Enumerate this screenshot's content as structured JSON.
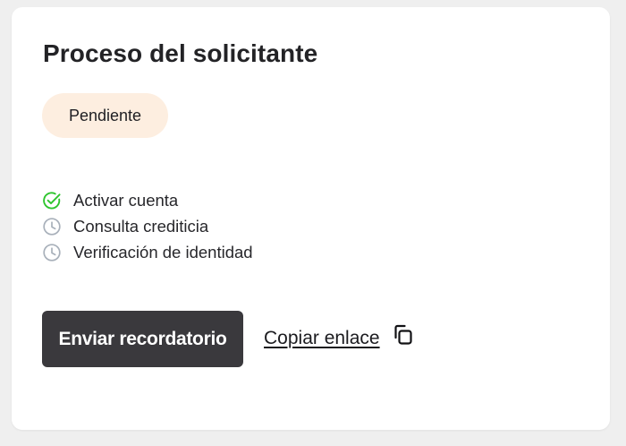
{
  "card": {
    "title": "Proceso del solicitante",
    "status_badge": "Pendiente",
    "steps": [
      {
        "label": "Activar cuenta",
        "status": "completed",
        "icon": "check-circle-icon"
      },
      {
        "label": "Consulta crediticia",
        "status": "pending",
        "icon": "clock-icon"
      },
      {
        "label": "Verificación de identidad",
        "status": "pending",
        "icon": "clock-icon"
      }
    ],
    "actions": {
      "send_reminder_label": "Enviar recordatorio",
      "copy_link_label": "Copiar enlace",
      "copy_icon": "copy-icon"
    }
  },
  "colors": {
    "page_background": "#efefef",
    "card_background": "#ffffff",
    "badge_background": "#fdeee0",
    "primary_button": "#3a393d",
    "completed_green": "#2ec52e",
    "pending_gray": "#a8b0ba"
  }
}
